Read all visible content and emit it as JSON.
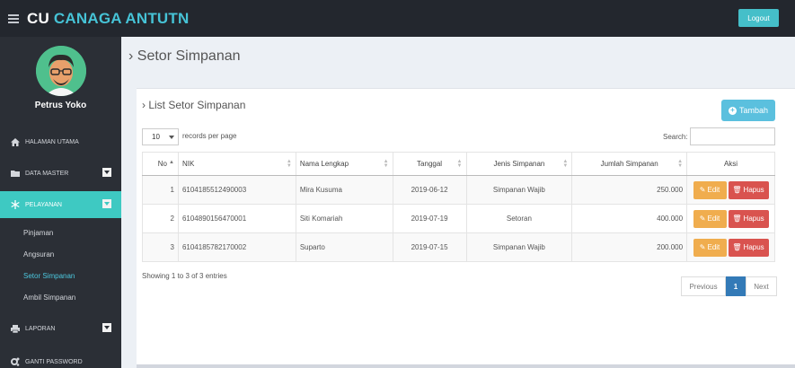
{
  "app": {
    "brand_1": "CU",
    "brand_2": "CANAGA ANTUTN",
    "logout_label": "Logout"
  },
  "sidebar": {
    "user_name": "Petrus Yoko",
    "items": [
      {
        "label": "HALAMAN UTAMA",
        "icon": "home-icon"
      },
      {
        "label": "DATA MASTER",
        "icon": "folder-icon"
      },
      {
        "label": "PELAYANAN",
        "icon": "snowflake-icon"
      },
      {
        "label": "LAPORAN",
        "icon": "print-icon"
      },
      {
        "label": "GANTI PASSWORD",
        "icon": "gears-icon"
      }
    ],
    "sub_items": [
      "Pinjaman",
      "Angsuran",
      "Setor Simpanan",
      "Ambil Simpanan"
    ]
  },
  "page": {
    "title": "Setor Simpanan",
    "box_title": "List Setor Simpanan",
    "add_label": "Tambah"
  },
  "table_controls": {
    "length_value": "10",
    "length_text": "records per page",
    "search_label": "Search:"
  },
  "table": {
    "headers": [
      "No",
      "NIK",
      "Nama Lengkap",
      "Tanggal",
      "Jenis Simpanan",
      "Jumlah Simpanan",
      "Aksi"
    ],
    "rows": [
      {
        "no": "1",
        "nik": "6104185512490003",
        "nama": "Mira Kusuma",
        "tanggal": "2019-06-12",
        "jenis": "Simpanan Wajib",
        "jumlah": "250.000"
      },
      {
        "no": "2",
        "nik": "6104890156470001",
        "nama": "Siti Komariah",
        "tanggal": "2019-07-19",
        "jenis": "Setoran",
        "jumlah": "400.000"
      },
      {
        "no": "3",
        "nik": "6104185782170002",
        "nama": "Suparto",
        "tanggal": "2019-07-15",
        "jenis": "Simpanan Wajib",
        "jumlah": "200.000"
      }
    ],
    "edit_label": "Edit",
    "delete_label": "Hapus"
  },
  "footer": {
    "info": "Showing 1 to 3 of 3 entries",
    "prev": "Previous",
    "page": "1",
    "next": "Next"
  },
  "colors": {
    "topbar": "#23272e",
    "sidebar": "#2b2f36",
    "accent": "#3ec9c2",
    "brand_highlight": "#46c3d6",
    "edit": "#f0ad4e",
    "delete": "#d9534f",
    "page_active": "#337ab7"
  }
}
